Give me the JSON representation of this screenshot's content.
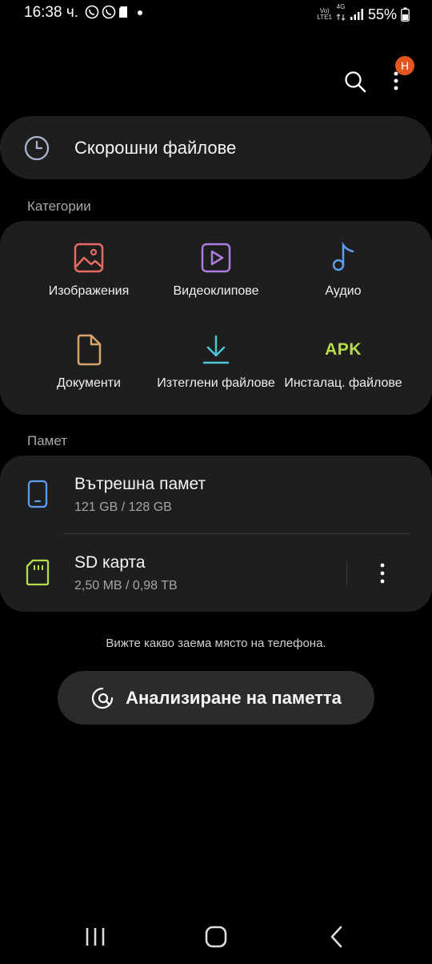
{
  "status_bar": {
    "time": "16:38 ч.",
    "network_top": "Vo)",
    "network_bottom": "LTE1",
    "data_type": "4G",
    "battery": "55%"
  },
  "header": {
    "badge_text": "Н",
    "search_icon": "search-icon",
    "more_icon": "more-vertical-icon"
  },
  "recent": {
    "label": "Скорошни файлове",
    "icon": "clock-icon"
  },
  "categories": {
    "title": "Категории",
    "items": [
      {
        "label": "Изображения",
        "icon": "image-icon",
        "color": "#e86b63"
      },
      {
        "label": "Видеоклипове",
        "icon": "video-icon",
        "color": "#b07be0"
      },
      {
        "label": "Аудио",
        "icon": "music-note-icon",
        "color": "#5b9ef0"
      },
      {
        "label": "Документи",
        "icon": "document-icon",
        "color": "#d6a56e"
      },
      {
        "label": "Изтеглени файлове",
        "icon": "download-icon",
        "color": "#4cc5d6"
      },
      {
        "label": "Инсталац. файлове",
        "icon": "apk-icon",
        "apk_text": "APK",
        "color": "#b6dc4a"
      }
    ]
  },
  "storage": {
    "title": "Памет",
    "internal": {
      "label": "Вътрешна памет",
      "usage": "121 GB / 128 GB",
      "color": "#5b9ef0"
    },
    "sd": {
      "label": "SD карта",
      "usage": "2,50 MB / 0,98 TB",
      "color": "#b6dc4a"
    }
  },
  "hint": "Вижте какво заема място на телефона.",
  "analyze_button": "Анализиране на паметта",
  "colors": {
    "background": "#000000",
    "card": "#1e1e1e",
    "button": "#2b2b2b",
    "badge": "#e2571e"
  }
}
